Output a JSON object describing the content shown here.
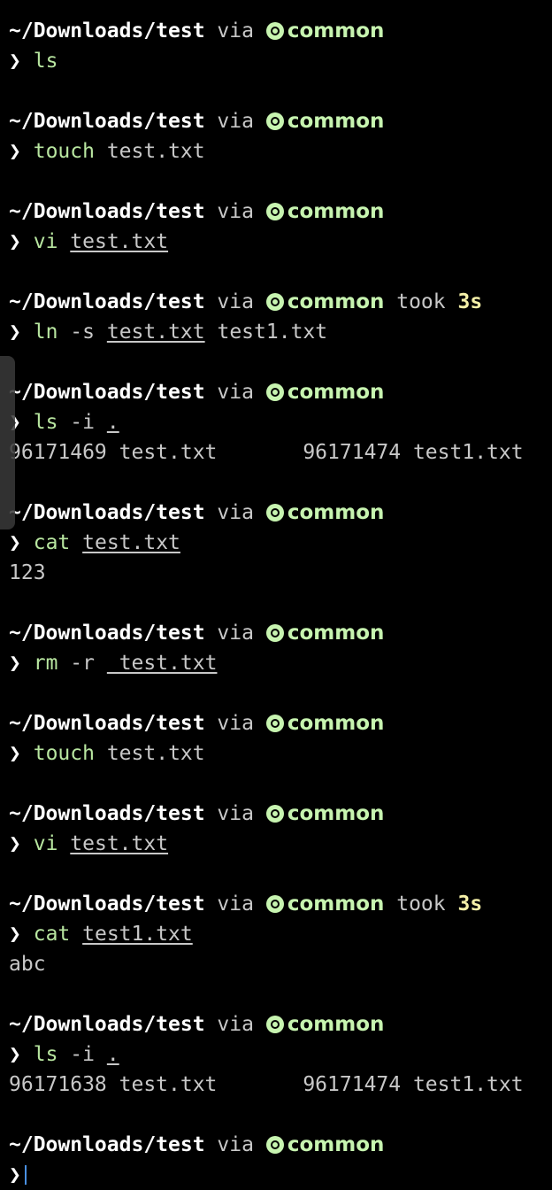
{
  "prompt": {
    "path": "~/Downloads/test",
    "via": "via",
    "env_name": "common",
    "took_label": "took",
    "chevron": "❯"
  },
  "colors": {
    "background": "#000000",
    "path": "#ffffff",
    "env": "#c7f4b0",
    "command": "#b8e6a0",
    "took_value": "#f5f0a8",
    "output": "#c8c8c8",
    "cursor": "#4a90e2"
  },
  "entries": [
    {
      "cmd": "ls",
      "args": [],
      "output": []
    },
    {
      "cmd": "touch",
      "args": [
        {
          "text": "test.txt",
          "underline": false
        }
      ],
      "output": []
    },
    {
      "cmd": "vi",
      "args": [
        {
          "text": "test.txt",
          "underline": true
        }
      ],
      "output": []
    },
    {
      "cmd": "ln",
      "args": [
        {
          "text": "-s",
          "underline": false
        },
        {
          "text": "test.txt",
          "underline": true
        },
        {
          "text": "test1.txt",
          "underline": false
        }
      ],
      "output": [],
      "took": "3s"
    },
    {
      "cmd": "ls",
      "args": [
        {
          "text": "-i",
          "underline": false
        },
        {
          "text": ".",
          "underline": true
        }
      ],
      "output": [
        "96171469 test.txt       96171474 test1.txt"
      ]
    },
    {
      "cmd": "cat",
      "args": [
        {
          "text": "test.txt",
          "underline": true
        }
      ],
      "output": [
        "123"
      ]
    },
    {
      "cmd": "rm",
      "args": [
        {
          "text": "-r",
          "underline": false
        },
        {
          "text": " test.txt",
          "underline": true
        }
      ],
      "output": []
    },
    {
      "cmd": "touch",
      "args": [
        {
          "text": "test.txt",
          "underline": false
        }
      ],
      "output": []
    },
    {
      "cmd": "vi",
      "args": [
        {
          "text": "test.txt",
          "underline": true
        }
      ],
      "output": []
    },
    {
      "cmd": "cat",
      "args": [
        {
          "text": "test1.txt",
          "underline": true
        }
      ],
      "output": [
        "abc"
      ],
      "took": "3s"
    },
    {
      "cmd": "ls",
      "args": [
        {
          "text": "-i",
          "underline": false
        },
        {
          "text": ".",
          "underline": true
        }
      ],
      "output": [
        "96171638 test.txt       96171474 test1.txt"
      ]
    }
  ]
}
